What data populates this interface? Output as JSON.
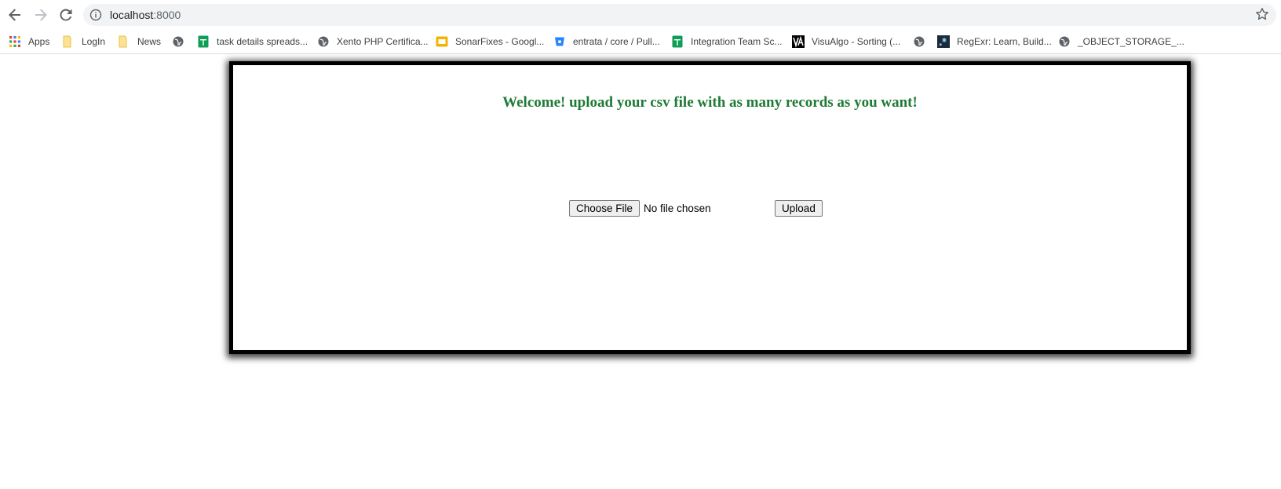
{
  "browser": {
    "url_host": "localhost",
    "url_port": ":8000",
    "bookmarks": [
      {
        "label": "Apps",
        "icon": "apps-grid-icon"
      },
      {
        "label": "LogIn",
        "icon": "folder-icon"
      },
      {
        "label": "News",
        "icon": "folder-icon"
      },
      {
        "label": "",
        "icon": "globe-icon"
      },
      {
        "label": "task details spreads...",
        "icon": "google-sheets-icon"
      },
      {
        "label": "Xento PHP Certifica...",
        "icon": "globe-icon"
      },
      {
        "label": "SonarFixes - Googl...",
        "icon": "google-slides-icon"
      },
      {
        "label": "entrata / core / Pull...",
        "icon": "bitbucket-icon"
      },
      {
        "label": "Integration Team Sc...",
        "icon": "google-sheets-icon"
      },
      {
        "label": "VisuAlgo - Sorting (...",
        "icon": "visualgo-icon"
      },
      {
        "label": "",
        "icon": "globe-icon"
      },
      {
        "label": "RegExr: Learn, Build...",
        "icon": "regexr-icon"
      },
      {
        "label": "_OBJECT_STORAGE_...",
        "icon": "globe-icon"
      }
    ]
  },
  "page": {
    "welcome": "Welcome! upload your csv file with as many records as you want!",
    "choose_file_label": "Choose File",
    "no_file_text": "No file chosen",
    "upload_label": "Upload"
  },
  "colors": {
    "welcome_text": "#1e7a34",
    "card_border": "#000000"
  }
}
